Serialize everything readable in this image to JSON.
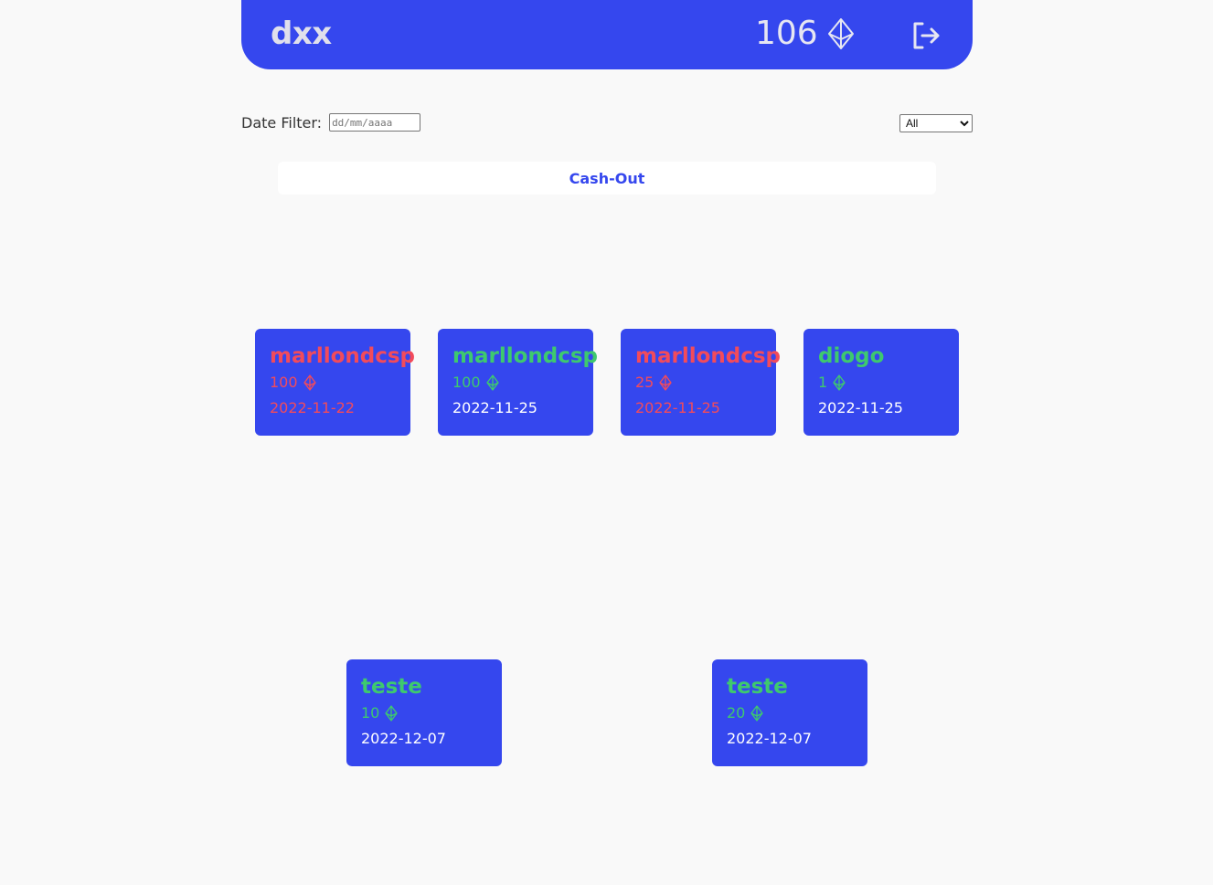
{
  "header": {
    "logo": "dxx",
    "balance": "106",
    "balance_icon": "ethereum-icon",
    "logout_icon": "logout-icon"
  },
  "filter": {
    "label": "Date Filter:",
    "date_placeholder": "dd/mm/aaaa",
    "type_selected": "All"
  },
  "cashout_label": "Cash-Out",
  "colors": {
    "primary": "#3547ee",
    "debit": "#f24b5b",
    "credit": "#3ec96e",
    "background": "#f9f9f9"
  },
  "transactions": [
    {
      "name": "marllondcsp",
      "amount": "100",
      "date": "2022-11-22",
      "type": "debit"
    },
    {
      "name": "marllondcsp",
      "amount": "100",
      "date": "2022-11-25",
      "type": "credit"
    },
    {
      "name": "marllondcsp",
      "amount": "25",
      "date": "2022-11-25",
      "type": "debit"
    },
    {
      "name": "diogo",
      "amount": "1",
      "date": "2022-11-25",
      "type": "credit"
    },
    {
      "name": "teste",
      "amount": "10",
      "date": "2022-12-07",
      "type": "credit"
    },
    {
      "name": "teste",
      "amount": "20",
      "date": "2022-12-07",
      "type": "credit"
    }
  ]
}
